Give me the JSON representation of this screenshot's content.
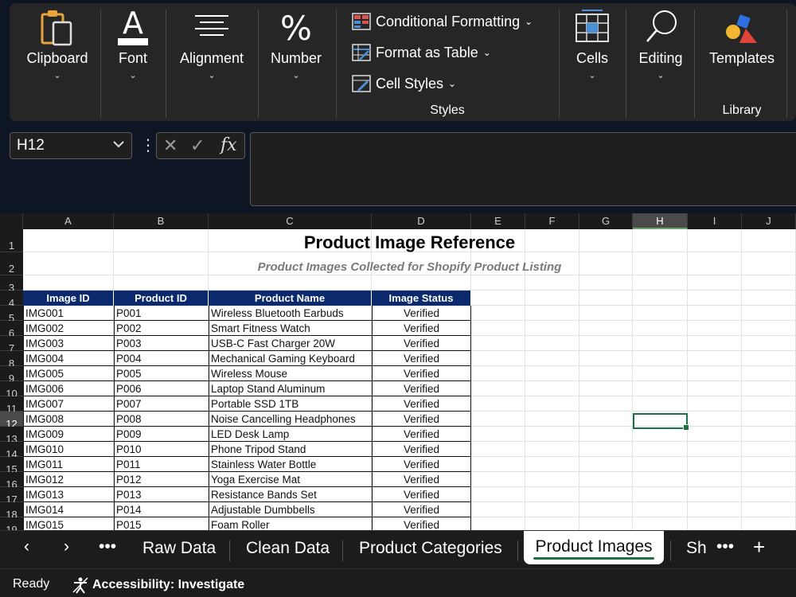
{
  "ribbon": {
    "clipboard": "Clipboard",
    "font": "Font",
    "alignment": "Alignment",
    "number": "Number",
    "conditional_formatting": "Conditional Formatting",
    "format_as_table": "Format as Table",
    "cell_styles": "Cell Styles",
    "styles_group": "Styles",
    "cells": "Cells",
    "editing": "Editing",
    "templates": "Templates",
    "library_group": "Library"
  },
  "formula_bar": {
    "name_box": "H12",
    "fx": "fx",
    "formula": ""
  },
  "columns": [
    "A",
    "B",
    "C",
    "D",
    "E",
    "F",
    "G",
    "H",
    "I",
    "J"
  ],
  "selected_column": "H",
  "rows": [
    "1",
    "2",
    "3",
    "4",
    "5",
    "6",
    "7",
    "8",
    "9",
    "10",
    "11",
    "12",
    "13",
    "14",
    "15",
    "16",
    "17",
    "18",
    "19"
  ],
  "selected_row": "12",
  "sheet": {
    "title": "Product Image Reference",
    "subtitle": "Product Images Collected for Shopify Product Listing",
    "headers": [
      "Image ID",
      "Product ID",
      "Product Name",
      "Image Status"
    ],
    "data": [
      [
        "IMG001",
        "P001",
        "Wireless Bluetooth Earbuds",
        "Verified"
      ],
      [
        "IMG002",
        "P002",
        "Smart Fitness Watch",
        "Verified"
      ],
      [
        "IMG003",
        "P003",
        "USB-C Fast Charger 20W",
        "Verified"
      ],
      [
        "IMG004",
        "P004",
        "Mechanical Gaming Keyboard",
        "Verified"
      ],
      [
        "IMG005",
        "P005",
        "Wireless Mouse",
        "Verified"
      ],
      [
        "IMG006",
        "P006",
        "Laptop Stand Aluminum",
        "Verified"
      ],
      [
        "IMG007",
        "P007",
        "Portable SSD 1TB",
        "Verified"
      ],
      [
        "IMG008",
        "P008",
        "Noise Cancelling Headphones",
        "Verified"
      ],
      [
        "IMG009",
        "P009",
        "LED Desk Lamp",
        "Verified"
      ],
      [
        "IMG010",
        "P010",
        "Phone Tripod Stand",
        "Verified"
      ],
      [
        "IMG011",
        "P011",
        "Stainless Water Bottle",
        "Verified"
      ],
      [
        "IMG012",
        "P012",
        "Yoga Exercise Mat",
        "Verified"
      ],
      [
        "IMG013",
        "P013",
        "Resistance Bands Set",
        "Verified"
      ],
      [
        "IMG014",
        "P014",
        "Adjustable Dumbbells",
        "Verified"
      ],
      [
        "IMG015",
        "P015",
        "Foam Roller",
        "Verified"
      ]
    ]
  },
  "tabs": {
    "raw_data": "Raw Data",
    "clean_data": "Clean Data",
    "product_categories": "Product Categories",
    "product_images": "Product Images",
    "partial": "Sh"
  },
  "status": {
    "ready": "Ready",
    "accessibility": "Accessibility: Investigate"
  }
}
